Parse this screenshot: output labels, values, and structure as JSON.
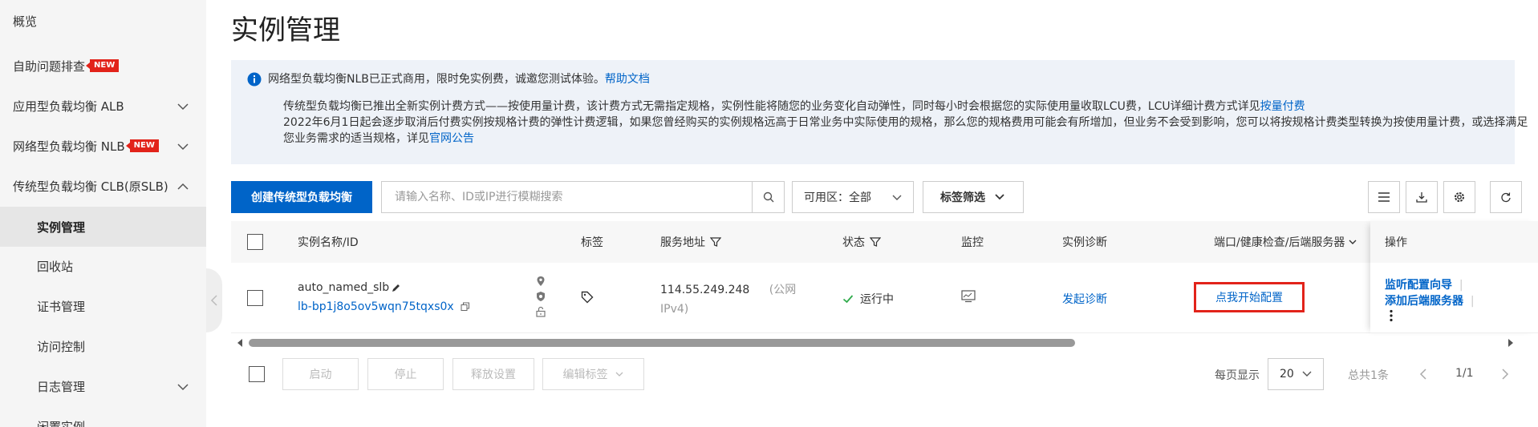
{
  "sidebar": {
    "items": [
      {
        "label": "概览"
      },
      {
        "label": "自助问题排查",
        "badge": "NEW"
      },
      {
        "label": "应用型负载均衡 ALB"
      },
      {
        "label": "网络型负载均衡 NLB",
        "badge": "NEW"
      },
      {
        "label": "传统型负载均衡 CLB(原SLB)"
      },
      {
        "label": "实例管理",
        "active": true
      },
      {
        "label": "回收站"
      },
      {
        "label": "证书管理"
      },
      {
        "label": "访问控制"
      },
      {
        "label": "日志管理"
      },
      {
        "label": "闲置实例"
      }
    ]
  },
  "page": {
    "title": "实例管理"
  },
  "notice": {
    "line1_text": "网络型负载均衡NLB已正式商用，限时免实例费，诚邀您测试体验。",
    "line1_link": "帮助文档",
    "para1_text": "传统型负载均衡已推出全新实例计费方式——按使用量计费，该计费方式无需指定规格，实例性能将随您的业务变化自动弹性，同时每小时会根据您的实际使用量收取LCU费，LCU详细计费方式详见",
    "para1_link": "按量付费",
    "para2_text": "2022年6月1日起会逐步取消后付费实例按规格计费的弹性计费逻辑，如果您曾经购买的实例规格远高于日常业务中实际使用的规格，那么您的规格费用可能会有所增加，但业务不会受到影响，您可以将按规格计费类型转换为按使用量计费，或选择满足您业务需求的适当规格，详见",
    "para2_link": "官网公告"
  },
  "toolbar": {
    "create_label": "创建传统型负载均衡",
    "search_placeholder": "请输入名称、ID或IP进行模糊搜索",
    "zone_label": "可用区：",
    "zone_value": "全部",
    "tag_filter_label": "标签筛选"
  },
  "table": {
    "headers": {
      "name": "实例名称/ID",
      "tag": "标签",
      "address": "服务地址",
      "status": "状态",
      "monitor": "监控",
      "diagnosis": "实例诊断",
      "ports": "端口/健康检查/后端服务器",
      "ops": "操作"
    },
    "rows": [
      {
        "name": "auto_named_slb",
        "id": "lb-bp1j8o5ov5wqn75tqxs0x",
        "ip": "114.55.249.248",
        "ip_type": "(公网",
        "ip_version": "IPv4)",
        "status": "运行中",
        "diagnosis": "发起诊断",
        "config_link": "点我开始配置",
        "op1": "监听配置向导",
        "op2": "添加后端服务器"
      }
    ]
  },
  "footer": {
    "buttons": [
      "启动",
      "停止",
      "释放设置",
      "编辑标签"
    ],
    "per_page_label": "每页显示",
    "page_size": "20",
    "total": "总共1条",
    "page": "1/1"
  },
  "colors": {
    "primary": "#0064c8",
    "success": "#2eaa4a",
    "highlight": "#e2231a"
  }
}
